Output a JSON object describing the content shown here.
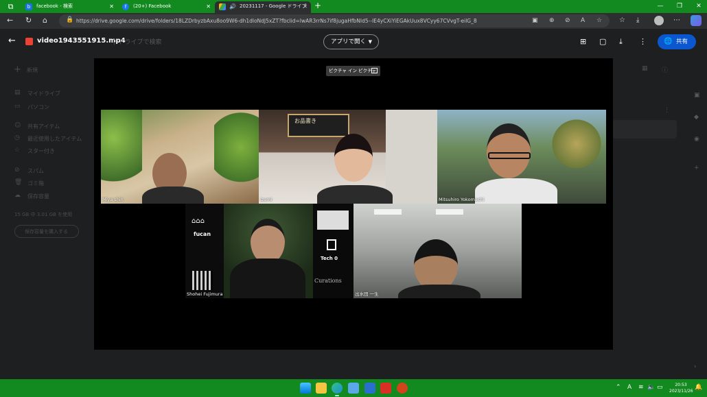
{
  "browser": {
    "tabs": [
      {
        "title": "facebook - 検索"
      },
      {
        "title": "(20+) Facebook"
      },
      {
        "title": "20231117 - Google ドライブ"
      }
    ],
    "url": "https://drive.google.com/drive/folders/18LZDrbyzbAxu8oo9W6-dh1dloNdJ5xZT?fbclid=IwAR3rrNs7if8jugaHfbNId5--IE4yCXiYiEGAkUux8VCyy67CVvgT-eilG_8"
  },
  "drive_background": {
    "new_label": "新規",
    "nav": [
      "マイドライブ",
      "パソコン",
      "共有アイテム",
      "最近使用したアイテム",
      "スター付き",
      "スパム",
      "ゴミ箱",
      "保存容量"
    ],
    "storage_text": "15 GB 中 3.01 GB を使用",
    "buy_storage": "保存容量を購入する",
    "search_placeholder": "ドライブで検索"
  },
  "preview": {
    "filename": "video1943551915.mp4",
    "open_with": "アプリで開く",
    "share": "共有",
    "pip_label": "ピクチャ イン ピクチャ"
  },
  "participants": [
    {
      "name": "Miya shin"
    },
    {
      "name": "izumi"
    },
    {
      "name": "Mitsuhiro Yokomachi"
    },
    {
      "name": "Shohei Fujimura"
    },
    {
      "name": "出水田 一生"
    }
  ],
  "tile_text": {
    "fucan": "fucan",
    "tech0": "Tech 0",
    "curations": "Curations",
    "sign": "お品書き"
  },
  "taskbar": {
    "time": "20:53",
    "date": "2023/11/26",
    "ime": "A"
  },
  "colors": {
    "chrome_green": "#138a20",
    "share_blue": "#0b57d0",
    "drive_dark": "#1e1f20"
  }
}
